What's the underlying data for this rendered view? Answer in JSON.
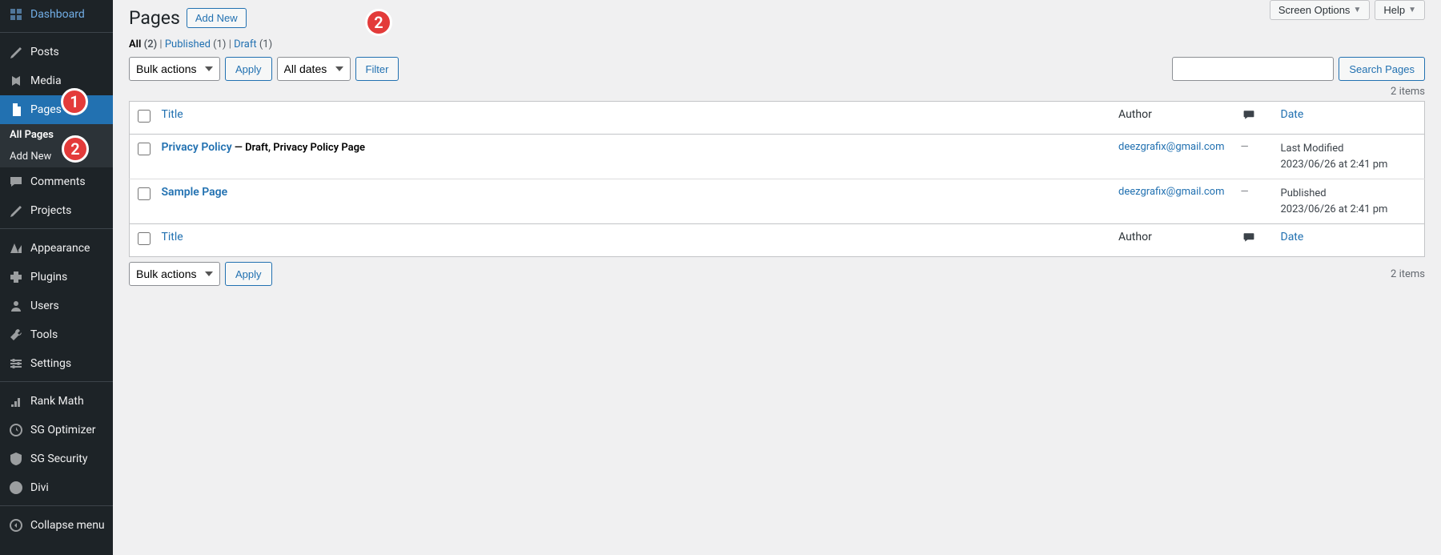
{
  "sidebar": {
    "items": [
      {
        "label": "Dashboard",
        "icon": "dashboard"
      },
      {
        "label": "Posts",
        "icon": "posts"
      },
      {
        "label": "Media",
        "icon": "media"
      },
      {
        "label": "Pages",
        "icon": "pages",
        "active": true
      },
      {
        "label": "Comments",
        "icon": "comments"
      },
      {
        "label": "Projects",
        "icon": "projects"
      },
      {
        "label": "Appearance",
        "icon": "appearance"
      },
      {
        "label": "Plugins",
        "icon": "plugins"
      },
      {
        "label": "Users",
        "icon": "users"
      },
      {
        "label": "Tools",
        "icon": "tools"
      },
      {
        "label": "Settings",
        "icon": "settings"
      },
      {
        "label": "Rank Math",
        "icon": "rankmath"
      },
      {
        "label": "SG Optimizer",
        "icon": "sgoptimizer"
      },
      {
        "label": "SG Security",
        "icon": "sgsecurity"
      },
      {
        "label": "Divi",
        "icon": "divi"
      },
      {
        "label": "Collapse menu",
        "icon": "collapse"
      }
    ],
    "submenu": [
      {
        "label": "All Pages",
        "current": true
      },
      {
        "label": "Add New"
      }
    ]
  },
  "badges": {
    "pages": "1",
    "addnew": "2",
    "headeraddnew": "2"
  },
  "topbar": {
    "screen_options": "Screen Options",
    "help": "Help"
  },
  "header": {
    "title": "Pages",
    "add_new": "Add New"
  },
  "filters": {
    "all_label": "All",
    "all_count": "(2)",
    "published_label": "Published",
    "published_count": "(1)",
    "draft_label": "Draft",
    "draft_count": "(1)",
    "sep": " | "
  },
  "actions": {
    "bulk_actions": "Bulk actions",
    "apply": "Apply",
    "all_dates": "All dates",
    "filter": "Filter",
    "search": "Search Pages",
    "items_count": "2 items"
  },
  "table": {
    "columns": {
      "title": "Title",
      "author": "Author",
      "date": "Date"
    },
    "rows": [
      {
        "title": "Privacy Policy",
        "state": " — Draft, Privacy Policy Page",
        "author": "deezgrafix@gmail.com",
        "comments": "—",
        "date_line1": "Last Modified",
        "date_line2": "2023/06/26 at 2:41 pm"
      },
      {
        "title": "Sample Page",
        "state": "",
        "author": "deezgrafix@gmail.com",
        "comments": "—",
        "date_line1": "Published",
        "date_line2": "2023/06/26 at 2:41 pm"
      }
    ]
  }
}
